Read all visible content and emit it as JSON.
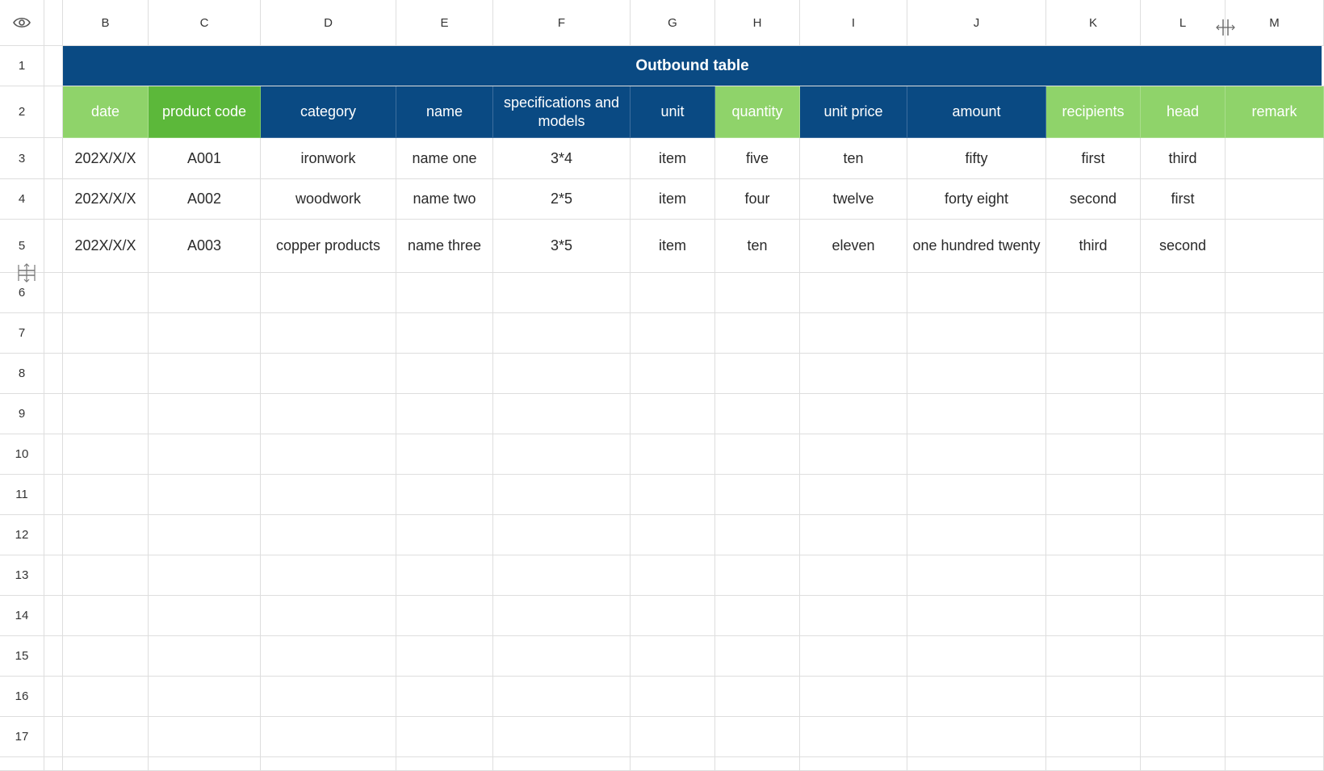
{
  "columns": [
    "B",
    "C",
    "D",
    "E",
    "F",
    "G",
    "H",
    "I",
    "J",
    "K",
    "L",
    "M"
  ],
  "rows": [
    "1",
    "2",
    "3",
    "4",
    "5",
    "6",
    "7",
    "8",
    "9",
    "10",
    "11",
    "12",
    "13",
    "14",
    "15",
    "16",
    "17"
  ],
  "title": "Outbound table",
  "headers": [
    {
      "label": "date",
      "style": "green"
    },
    {
      "label": "product code",
      "style": "darkgreen"
    },
    {
      "label": "category",
      "style": "blue"
    },
    {
      "label": "name",
      "style": "blue"
    },
    {
      "label": "specifications and models",
      "style": "blue"
    },
    {
      "label": "unit",
      "style": "blue"
    },
    {
      "label": "quantity",
      "style": "green"
    },
    {
      "label": "unit price",
      "style": "blue"
    },
    {
      "label": "amount",
      "style": "blue"
    },
    {
      "label": "recipients",
      "style": "green"
    },
    {
      "label": "head",
      "style": "green"
    },
    {
      "label": "remark",
      "style": "green"
    }
  ],
  "records": [
    [
      "202X/X/X",
      "A001",
      "ironwork",
      "name one",
      "3*4",
      "item",
      "five",
      "ten",
      "fifty",
      "first",
      "third",
      ""
    ],
    [
      "202X/X/X",
      "A002",
      "woodwork",
      "name two",
      "2*5",
      "item",
      "four",
      "twelve",
      "forty eight",
      "second",
      "first",
      ""
    ],
    [
      "202X/X/X",
      "A003",
      "copper products",
      "name three",
      "3*5",
      "item",
      "ten",
      "eleven",
      "one hundred twenty",
      "third",
      "second",
      ""
    ]
  ],
  "colors": {
    "title_bg": "#0a4a83",
    "header_blue": "#0a4a83",
    "header_green": "#8fd36a",
    "header_darkgreen": "#5cb83a",
    "grid": "#dedede"
  },
  "icons": {
    "corner": "eye-icon",
    "column_resize": "column-resize-icon",
    "row_resize": "row-resize-icon"
  }
}
